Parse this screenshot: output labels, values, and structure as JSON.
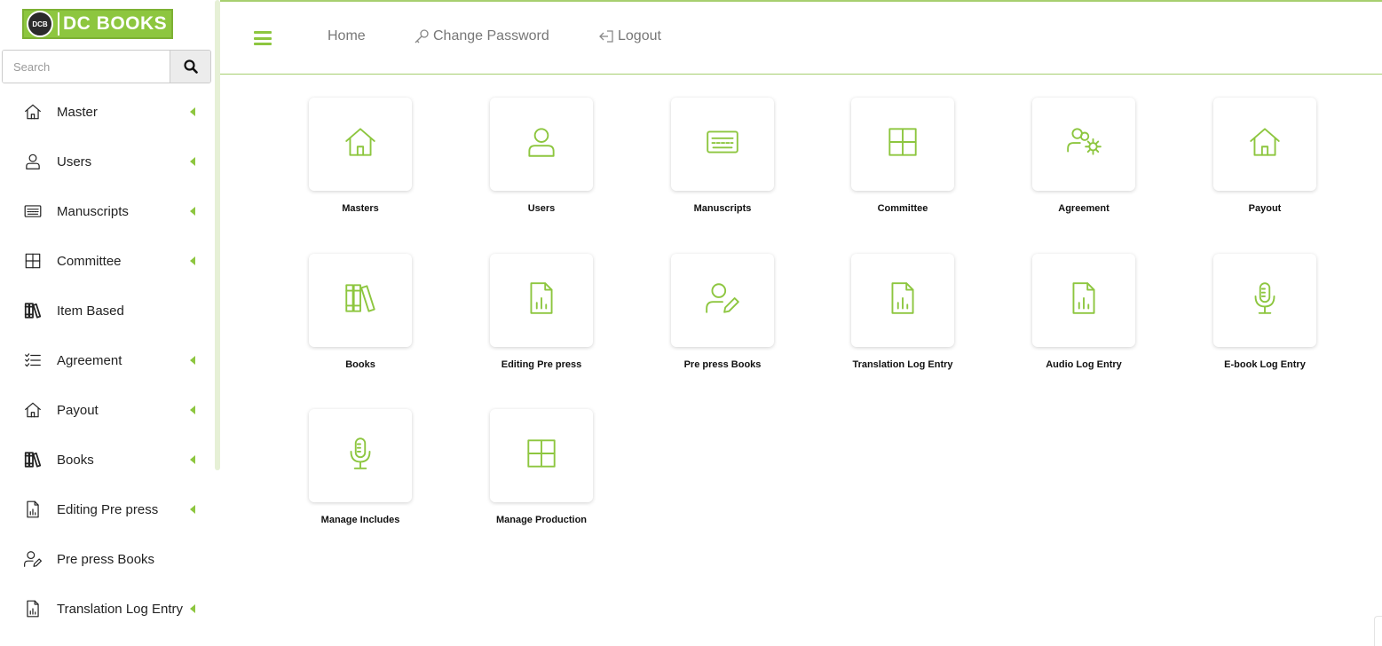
{
  "brand": {
    "name": "DC BOOKS",
    "emblem_text": "DCB",
    "color": "#8dc63f"
  },
  "search": {
    "placeholder": "Search",
    "icon": "search-icon"
  },
  "sidebar": {
    "items": [
      {
        "label": "Master",
        "icon": "home-icon",
        "has_submenu": true
      },
      {
        "label": "Users",
        "icon": "user-icon",
        "has_submenu": true
      },
      {
        "label": "Manuscripts",
        "icon": "keyboard-icon",
        "has_submenu": true
      },
      {
        "label": "Committee",
        "icon": "grid-icon",
        "has_submenu": true
      },
      {
        "label": "Item Based",
        "icon": "books-icon",
        "has_submenu": false
      },
      {
        "label": "Agreement",
        "icon": "checklist-icon",
        "has_submenu": true
      },
      {
        "label": "Payout",
        "icon": "home-icon",
        "has_submenu": true
      },
      {
        "label": "Books",
        "icon": "books-icon",
        "has_submenu": true
      },
      {
        "label": "Editing Pre press",
        "icon": "file-chart-icon",
        "has_submenu": true
      },
      {
        "label": "Pre press Books",
        "icon": "user-edit-icon",
        "has_submenu": false
      },
      {
        "label": "Translation Log Entry",
        "icon": "file-chart-icon",
        "has_submenu": true
      }
    ]
  },
  "header": {
    "menu_icon": "hamburger-icon",
    "links": [
      {
        "label": "Home",
        "icon": ""
      },
      {
        "label": "Change Password",
        "icon": "key-icon"
      },
      {
        "label": "Logout",
        "icon": "logout-icon"
      }
    ]
  },
  "tiles": [
    {
      "label": "Masters",
      "icon": "home-icon"
    },
    {
      "label": "Users",
      "icon": "user-icon"
    },
    {
      "label": "Manuscripts",
      "icon": "keyboard-icon"
    },
    {
      "label": "Committee",
      "icon": "grid-icon"
    },
    {
      "label": "Agreement",
      "icon": "users-gear-icon"
    },
    {
      "label": "Payout",
      "icon": "home-icon"
    },
    {
      "label": "Books",
      "icon": "books-icon"
    },
    {
      "label": "Editing Pre press",
      "icon": "file-chart-icon"
    },
    {
      "label": "Pre press Books",
      "icon": "user-edit-icon"
    },
    {
      "label": "Translation Log Entry",
      "icon": "file-chart-icon"
    },
    {
      "label": "Audio Log Entry",
      "icon": "file-chart-icon"
    },
    {
      "label": "E-book Log Entry",
      "icon": "microphone-icon"
    },
    {
      "label": "Manage Includes",
      "icon": "microphone-icon"
    },
    {
      "label": "Manage Production",
      "icon": "grid-icon"
    }
  ]
}
